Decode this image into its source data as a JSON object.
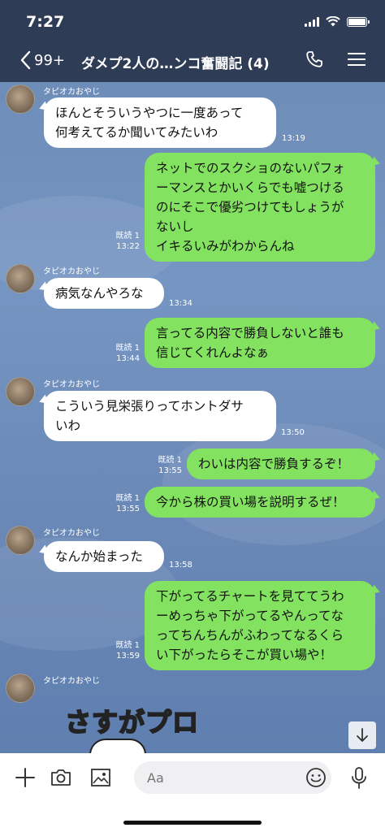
{
  "status": {
    "time": "7:27"
  },
  "header": {
    "back_count": "99+",
    "title": "ダメプ2人の…ンコ奮闘記 (4)"
  },
  "messages": [
    {
      "side": "in",
      "sender": "タピオカおやじ",
      "text": "ほんとそういうやつに一度あって\n何考えてるか聞いてみたいわ",
      "time": "13:19"
    },
    {
      "side": "out",
      "text": "ネットでのスクショのないパフォ\nーマンスとかいくらでも嘘つける\nのにそこで優劣つけてもしょうが\nないし\nイキるいみがわからんね",
      "read": "既読 1",
      "time": "13:22"
    },
    {
      "side": "in",
      "sender": "タピオカおやじ",
      "text": "病気なんやろな",
      "time": "13:34"
    },
    {
      "side": "out",
      "text": "言ってる内容で勝負しないと誰も\n信じてくれんよなぁ",
      "read": "既読 1",
      "time": "13:44"
    },
    {
      "side": "in",
      "sender": "タピオカおやじ",
      "text": "こういう見栄張りってホントダサ\nいわ",
      "time": "13:50"
    },
    {
      "side": "out",
      "text": "わいは内容で勝負するぞ！",
      "read": "既読 1",
      "time": "13:55"
    },
    {
      "side": "out",
      "text": "今から株の買い場を説明するぜ！",
      "read": "既読 1",
      "time": "13:55"
    },
    {
      "side": "in",
      "sender": "タピオカおやじ",
      "text": "なんか始まった",
      "time": "13:58"
    },
    {
      "side": "out",
      "text": "下がってるチャートを見ててうわ\nーめっちゃ下がってるやんってな\nってちんちんがふわってなるくら\nい下がったらそこが買い場や！",
      "read": "既読 1",
      "time": "13:59"
    },
    {
      "side": "in",
      "sender": "タピオカおやじ",
      "sticker": "さすがプロ"
    }
  ],
  "input": {
    "placeholder": "Aa"
  },
  "colors": {
    "header_bg": "#2f3c55",
    "out_bubble": "#84e261",
    "in_bubble": "#ffffff"
  }
}
